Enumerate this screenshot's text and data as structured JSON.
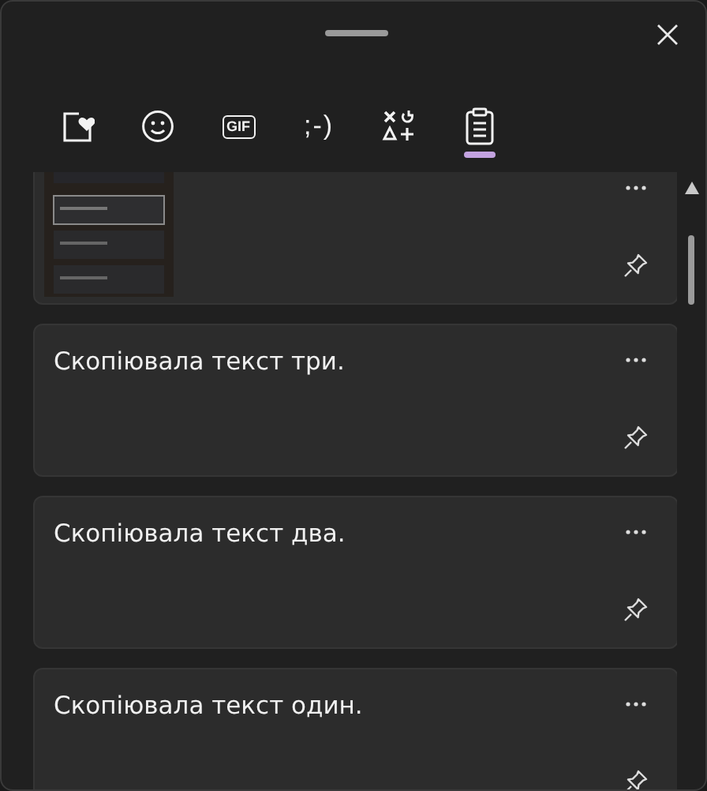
{
  "tabs": [
    {
      "kind": "favorites",
      "selected": false
    },
    {
      "kind": "emoji",
      "selected": false
    },
    {
      "kind": "gif",
      "label": "GIF",
      "selected": false
    },
    {
      "kind": "kaomoji",
      "label": ";-)",
      "selected": false
    },
    {
      "kind": "symbols",
      "selected": false
    },
    {
      "kind": "clipboard",
      "selected": true
    }
  ],
  "clipboard_items": [
    {
      "kind": "picture"
    },
    {
      "kind": "text",
      "text": "Скопіювала текст три."
    },
    {
      "kind": "text",
      "text": "Скопіювала текст два."
    },
    {
      "kind": "text",
      "text": "Скопіювала текст один."
    }
  ]
}
